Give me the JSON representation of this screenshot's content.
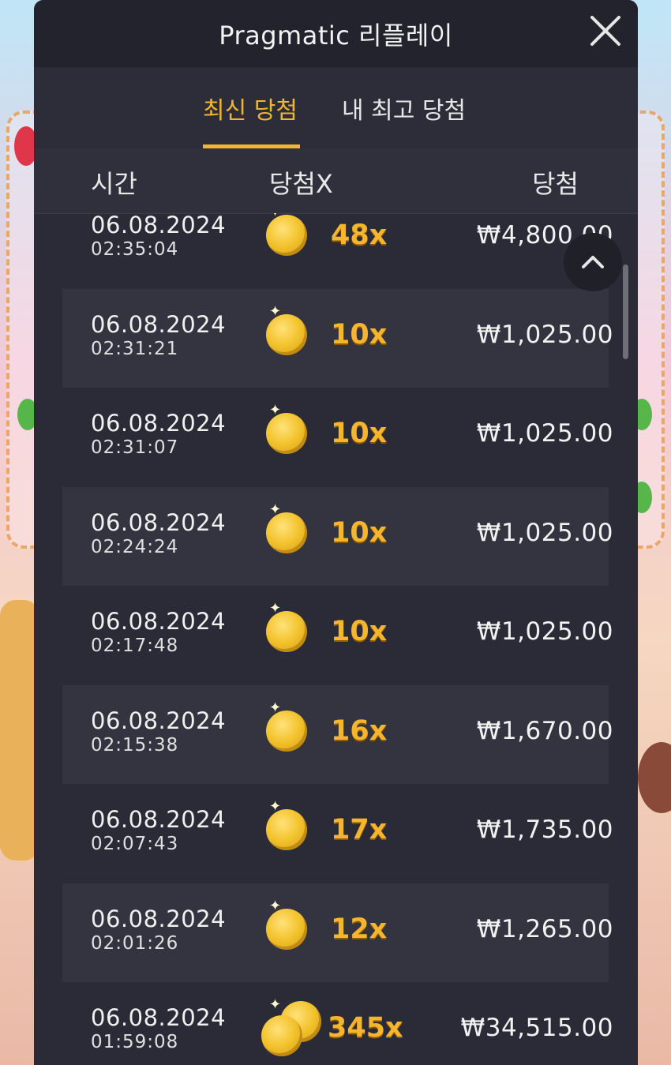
{
  "window": {
    "title": "Pragmatic 리플레이"
  },
  "tabs": [
    {
      "label": "최신 당첨",
      "active": true
    },
    {
      "label": "내 최고 당첨",
      "active": false
    }
  ],
  "columns": {
    "time": "시간",
    "multiplier": "당첨X",
    "win": "당첨"
  },
  "rows": [
    {
      "date": "06.08.2024",
      "time": "02:35:04",
      "multiplier": "48x",
      "win": "₩4,800.00",
      "coins": 1
    },
    {
      "date": "06.08.2024",
      "time": "02:31:21",
      "multiplier": "10x",
      "win": "₩1,025.00",
      "coins": 1
    },
    {
      "date": "06.08.2024",
      "time": "02:31:07",
      "multiplier": "10x",
      "win": "₩1,025.00",
      "coins": 1
    },
    {
      "date": "06.08.2024",
      "time": "02:24:24",
      "multiplier": "10x",
      "win": "₩1,025.00",
      "coins": 1
    },
    {
      "date": "06.08.2024",
      "time": "02:17:48",
      "multiplier": "10x",
      "win": "₩1,025.00",
      "coins": 1
    },
    {
      "date": "06.08.2024",
      "time": "02:15:38",
      "multiplier": "16x",
      "win": "₩1,670.00",
      "coins": 1
    },
    {
      "date": "06.08.2024",
      "time": "02:07:43",
      "multiplier": "17x",
      "win": "₩1,735.00",
      "coins": 1
    },
    {
      "date": "06.08.2024",
      "time": "02:01:26",
      "multiplier": "12x",
      "win": "₩1,265.00",
      "coins": 1
    },
    {
      "date": "06.08.2024",
      "time": "01:59:08",
      "multiplier": "345x",
      "win": "₩34,515.00",
      "coins": 2
    }
  ],
  "icons": {
    "close": "close-icon",
    "scroll_up": "chevron-up-icon",
    "coin": "coin-icon"
  },
  "colors": {
    "accent": "#f1b533",
    "panel": "#2a2b36",
    "title_bar": "#22232c"
  }
}
